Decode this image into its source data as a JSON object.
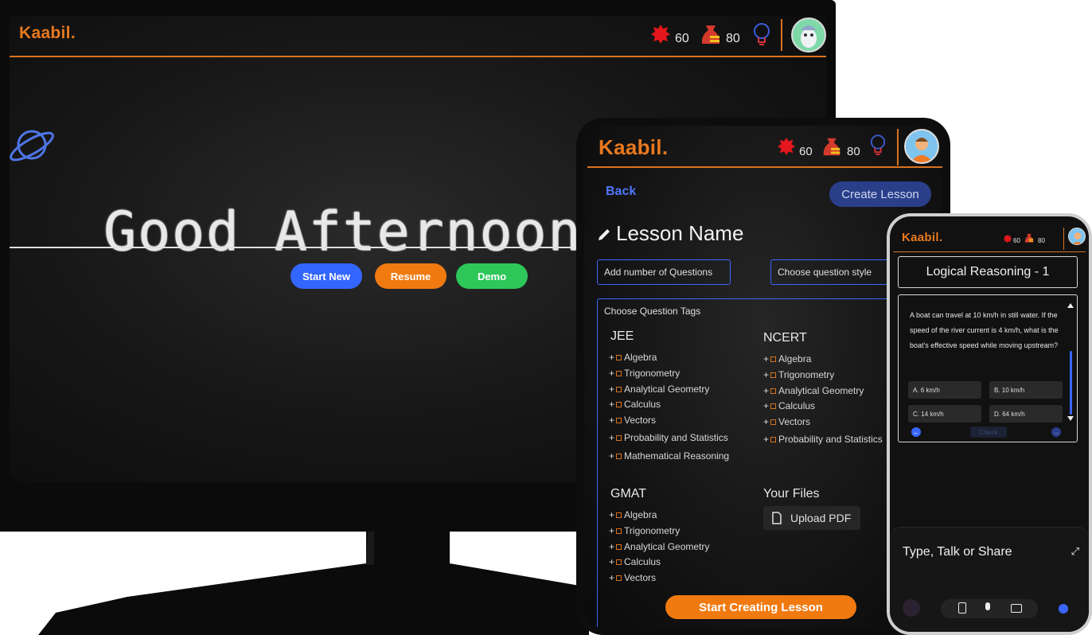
{
  "monitor": {
    "brand": "Kaabil.",
    "stats": {
      "badge_count": "60",
      "coins_count": "80"
    },
    "icons": [
      "burst-badge-icon",
      "money-bag-icon",
      "lightbulb-icon",
      "avatar-icon",
      "planet-icon"
    ],
    "greeting": "Good Afternoon, A",
    "buttons": {
      "start_new": "Start New",
      "resume": "Resume",
      "demo": "Demo"
    },
    "colors": {
      "accent": "#e8791e",
      "start_new": "#3366ff",
      "resume": "#f07a10",
      "demo": "#2ec75a"
    }
  },
  "tablet": {
    "brand": "Kaabil.",
    "stats": {
      "badge_count": "60",
      "coins_count": "80"
    },
    "back": "Back",
    "create_lesson": "Create Lesson",
    "lesson_name": "Lesson Name",
    "num_questions_placeholder": "Add number of Questions",
    "question_style_placeholder": "Choose question style",
    "tags_label": "Choose Question Tags",
    "groups": {
      "jee": {
        "title": "JEE",
        "items": [
          "Algebra",
          "Trigonometry",
          "Analytical Geometry",
          "Calculus",
          "Vectors",
          "Probability and Statistics",
          "Mathematical Reasoning"
        ]
      },
      "ncert": {
        "title": "NCERT",
        "items": [
          "Algebra",
          "Trigonometry",
          "Analytical Geometry",
          "Calculus",
          "Vectors",
          "Probability and Statistics"
        ]
      },
      "gmat": {
        "title": "GMAT",
        "items": [
          "Algebra",
          "Trigonometry",
          "Analytical Geometry",
          "Calculus",
          "Vectors"
        ]
      }
    },
    "files_title": "Your Files",
    "upload_pdf": "Upload PDF",
    "start_creating": "Start Creating Lesson"
  },
  "phone": {
    "brand": "Kaabil.",
    "stats": {
      "badge_count": "60",
      "coins_count": "80"
    },
    "quiz_title": "Logical Reasoning - 1",
    "question": "A boat can travel at 10 km/h in still water. If the speed of the river current is 4 km/h, what is the boat's effective speed while moving upstream?",
    "options": [
      "A. 6 km/h",
      "B. 10 km/h",
      "C. 14 km/h",
      "D. 64 km/h"
    ],
    "check": "Check",
    "input_placeholder": "Type, Talk or Share"
  }
}
